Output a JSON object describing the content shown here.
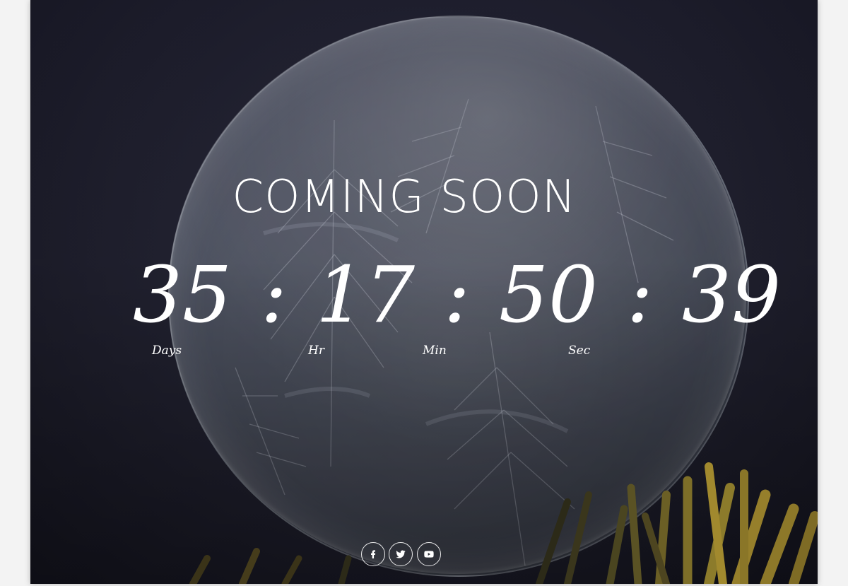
{
  "page": {
    "title": "COMING SOON"
  },
  "countdown": {
    "days": "35",
    "hours": "17",
    "minutes": "50",
    "seconds": "39",
    "separator": ":",
    "labels": {
      "days": "Days",
      "hours": "Hr",
      "minutes": "Min",
      "seconds": "Sec"
    }
  },
  "social": {
    "icons": [
      "facebook-icon",
      "twitter-icon",
      "youtube-icon"
    ]
  },
  "colors": {
    "text": "#ffffff",
    "background": "#1f1f2d"
  }
}
